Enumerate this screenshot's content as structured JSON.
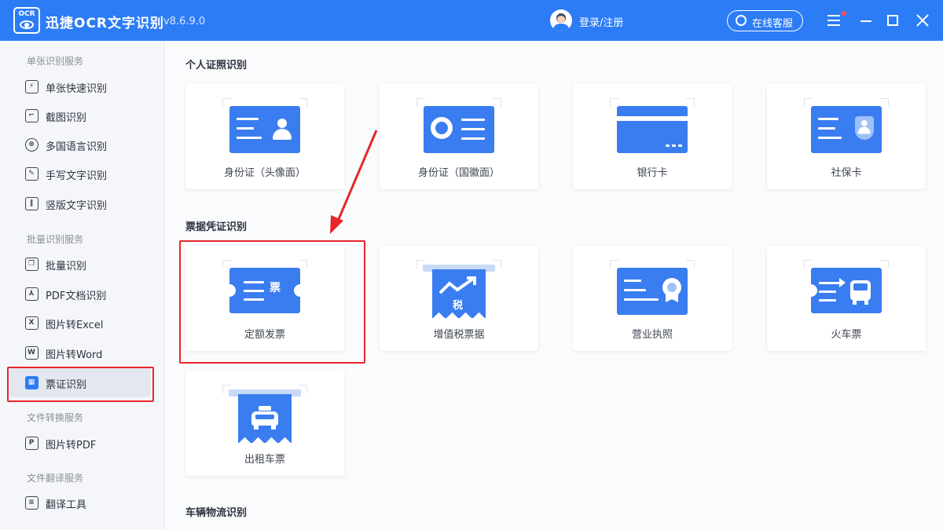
{
  "titlebar": {
    "logo_text": "OCR",
    "app_name": "迅捷OCR文字识别",
    "version": "v8.6.9.0",
    "login_text": "登录/注册",
    "service_label": "在线客服",
    "icons": [
      "logo-icon",
      "user-avatar",
      "headset-icon",
      "menu-icon",
      "minimize-icon",
      "maximize-icon",
      "close-icon"
    ]
  },
  "sidebar": {
    "sections": [
      {
        "title": "单张识别服务",
        "items": [
          {
            "label": "单张快速识别",
            "icon": "quick-scan-icon",
            "glyph": "⚡"
          },
          {
            "label": "截图识别",
            "icon": "crop-icon",
            "glyph": "⌐"
          },
          {
            "label": "多国语言识别",
            "icon": "globe-icon",
            "glyph": "⊕"
          },
          {
            "label": "手写文字识别",
            "icon": "pen-icon",
            "glyph": "✎"
          },
          {
            "label": "竖版文字识别",
            "icon": "vertical-text-icon",
            "glyph": "‖"
          }
        ]
      },
      {
        "title": "批量识别服务",
        "items": [
          {
            "label": "批量识别",
            "icon": "batch-icon",
            "glyph": "❐"
          },
          {
            "label": "PDF文档识别",
            "icon": "pdf-icon",
            "glyph": "⅄"
          },
          {
            "label": "图片转Excel",
            "icon": "excel-icon",
            "glyph": "X"
          },
          {
            "label": "图片转Word",
            "icon": "word-icon",
            "glyph": "W"
          },
          {
            "label": "票证识别",
            "icon": "ticket-icon",
            "glyph": "▦",
            "active": true
          }
        ]
      },
      {
        "title": "文件转换服务",
        "items": [
          {
            "label": "图片转PDF",
            "icon": "image-to-pdf-icon",
            "glyph": "P"
          }
        ]
      },
      {
        "title": "文件翻译服务",
        "items": [
          {
            "label": "翻译工具",
            "icon": "translate-icon",
            "glyph": "≡"
          }
        ]
      }
    ]
  },
  "main": {
    "groups": [
      {
        "title": "个人证照识别",
        "cards": [
          {
            "label": "身份证（头像面）",
            "icon": "id-card-front-icon"
          },
          {
            "label": "身份证（国徽面）",
            "icon": "id-card-back-icon"
          },
          {
            "label": "银行卡",
            "icon": "bank-card-icon"
          },
          {
            "label": "社保卡",
            "icon": "social-security-card-icon"
          }
        ]
      },
      {
        "title": "票据凭证识别",
        "cards": [
          {
            "label": "定额发票",
            "icon": "fixed-invoice-icon",
            "glyph": "票",
            "highlighted": true
          },
          {
            "label": "增值税票据",
            "icon": "vat-invoice-icon",
            "glyph": "税"
          },
          {
            "label": "营业执照",
            "icon": "business-license-icon"
          },
          {
            "label": "火车票",
            "icon": "train-ticket-icon"
          },
          {
            "label": "出租车票",
            "icon": "taxi-ticket-icon"
          }
        ]
      },
      {
        "title": "车辆物流识别",
        "cards": []
      }
    ]
  },
  "colors": {
    "brand": "#2c7cf6",
    "illustration": "#3a7df0",
    "highlight": "#e8262a",
    "sidebar_bg": "#f5f6fa"
  }
}
